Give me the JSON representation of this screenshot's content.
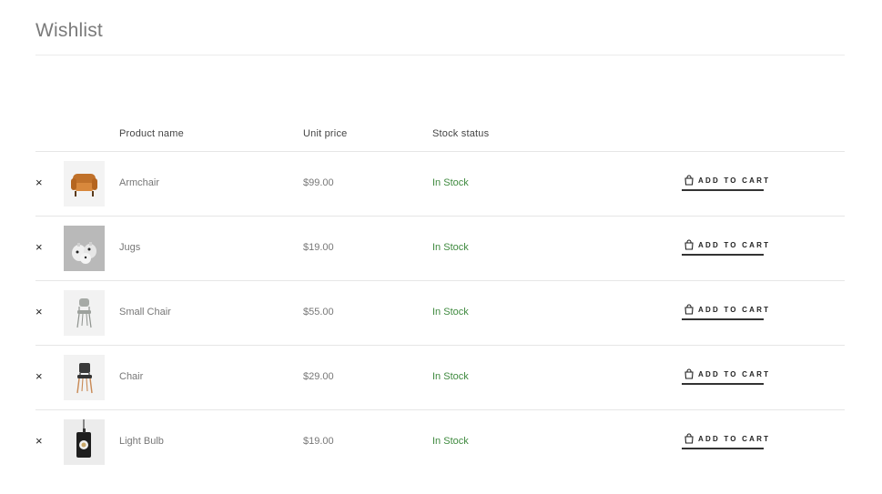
{
  "page": {
    "title": "Wishlist"
  },
  "table": {
    "headers": {
      "product_name": "Product name",
      "unit_price": "Unit price",
      "stock_status": "Stock status"
    },
    "remove_symbol": "×",
    "add_to_cart_label": "ADD TO CART",
    "rows": [
      {
        "name": "Armchair",
        "price": "$99.00",
        "stock": "In Stock",
        "image": "armchair-image"
      },
      {
        "name": "Jugs",
        "price": "$19.00",
        "stock": "In Stock",
        "image": "jugs-image"
      },
      {
        "name": "Small Chair",
        "price": "$55.00",
        "stock": "In Stock",
        "image": "small-chair-image"
      },
      {
        "name": "Chair",
        "price": "$29.00",
        "stock": "In Stock",
        "image": "chair-image"
      },
      {
        "name": "Light Bulb",
        "price": "$19.00",
        "stock": "In Stock",
        "image": "light-bulb-image"
      }
    ]
  },
  "colors": {
    "in_stock": "#3f8a3f",
    "title": "#7a7a7a",
    "text": "#777777"
  }
}
